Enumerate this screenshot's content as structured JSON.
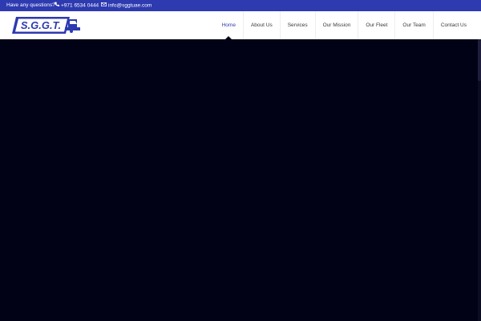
{
  "topbar": {
    "question": "Have any questions?",
    "phone": "+971 6534 0444",
    "email": "info@sggtuae.com",
    "phone_icon": "phone-icon",
    "email_icon": "envelope-icon"
  },
  "logo": {
    "text": "S.G.G.T.",
    "icon": "truck-icon"
  },
  "nav": {
    "items": [
      {
        "label": "Home"
      },
      {
        "label": "About Us"
      },
      {
        "label": "Services"
      },
      {
        "label": "Our Mission"
      },
      {
        "label": "Our Fleet"
      },
      {
        "label": "Our Team"
      },
      {
        "label": "Contact Us"
      }
    ],
    "active_index": 0
  },
  "colors": {
    "brand_blue": "#2d3ab0",
    "hero_bg": "#020216",
    "header_bg": "#ffffff"
  }
}
